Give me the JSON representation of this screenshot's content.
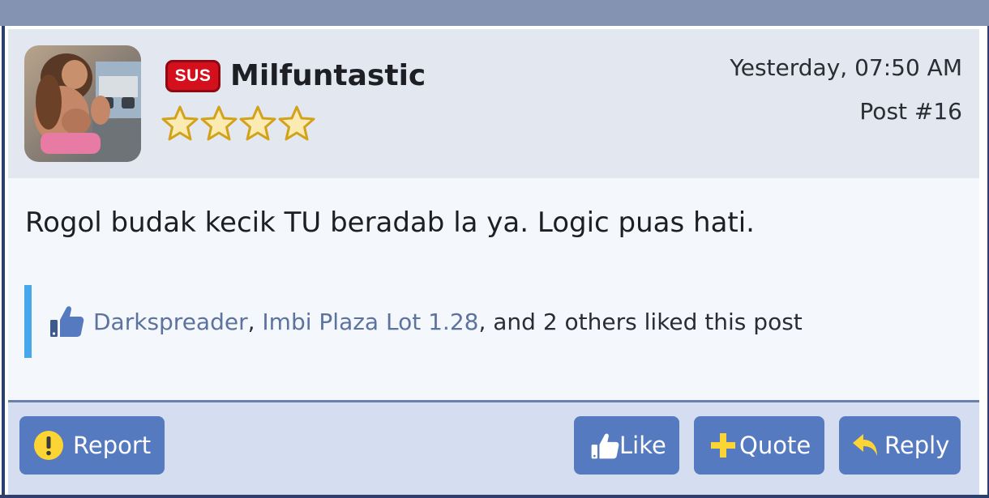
{
  "post": {
    "author": {
      "badge": "SUS",
      "username": "Milfuntastic",
      "rank_stars": 4
    },
    "timestamp": "Yesterday, 07:50 AM",
    "post_number": "Post #16",
    "message": "Rogol budak kecik TU beradab la ya. Logic puas hati.",
    "likes": {
      "users": [
        "Darkspreader",
        "Imbi Plaza Lot 1.28"
      ],
      "separator": ",",
      "suffix": ", and 2 others liked this post"
    }
  },
  "actions": {
    "report": "Report",
    "like": "Like",
    "quote": "Quote",
    "reply": "Reply"
  },
  "colors": {
    "accent": "#557ac0",
    "badge": "#d5101d",
    "link": "#5c739e",
    "likes_bar": "#47a7eb",
    "icon_yellow": "#fcd535"
  },
  "icons": {
    "report": "warning-circle-icon",
    "like": "thumbs-up-icon",
    "quote": "plus-icon",
    "reply": "reply-arrow-icon"
  }
}
